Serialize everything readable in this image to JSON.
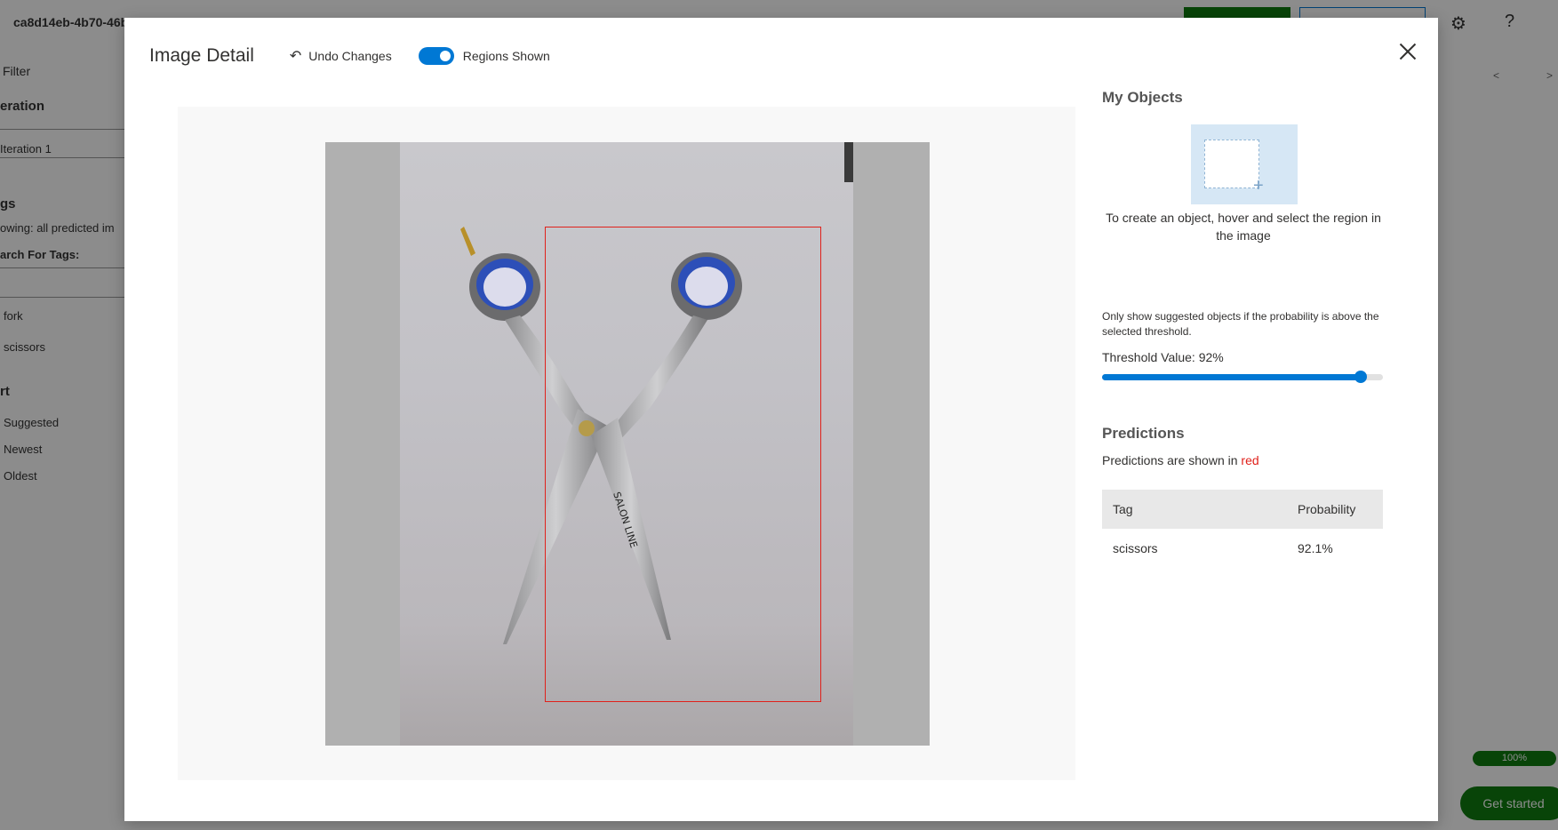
{
  "background": {
    "title": "ca8d14eb-4b70-46b",
    "sidebar": {
      "filter": "Filter",
      "iteration_heading": "eration",
      "iteration_value": "Iteration 1",
      "tags_heading": "gs",
      "showing": "owing: all predicted im",
      "search_label": "arch For Tags:",
      "tags": [
        "fork",
        "scissors"
      ],
      "sort_heading": "rt",
      "sort_options": [
        "Suggested",
        "Newest",
        "Oldest"
      ]
    },
    "progress": "100%",
    "get_started": "Get started",
    "prev_arrow": "<",
    "next_arrow": ">"
  },
  "modal": {
    "title": "Image Detail",
    "undo_label": "Undo Changes",
    "toggle_label": "Regions Shown",
    "toggle_on": true
  },
  "panel": {
    "objects_heading": "My Objects",
    "objects_hint": "To create an object, hover and select the region in the image",
    "threshold_note": "Only show suggested objects if the probability is above the selected threshold.",
    "threshold_label": "Threshold Value: 92%",
    "threshold_value": 0.92,
    "predictions_heading": "Predictions",
    "predictions_note_prefix": "Predictions are shown in",
    "predictions_note_color_word": "red",
    "table": {
      "headers": [
        "Tag",
        "Probability"
      ],
      "rows": [
        {
          "tag": "scissors",
          "probability": "92.1%"
        }
      ]
    }
  },
  "colors": {
    "accent": "#0078d4",
    "prediction_red": "#e0211b",
    "brand_green": "#107c10"
  },
  "icons": {
    "undo": "undo-icon",
    "close": "close-icon",
    "settings": "gear-icon",
    "help": "help-icon"
  }
}
